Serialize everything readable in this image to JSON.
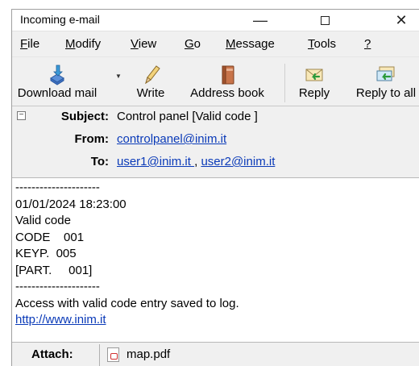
{
  "window": {
    "title": "Incoming e-mail",
    "minimize": "—",
    "close": "✕"
  },
  "menu": [
    {
      "label": "File",
      "underline": "F",
      "rest": "ile"
    },
    {
      "label": "Modify",
      "underline": "M",
      "rest": "odify"
    },
    {
      "label": "View",
      "underline": "V",
      "rest": "iew"
    },
    {
      "label": "Go",
      "underline": "G",
      "rest": "o"
    },
    {
      "label": "Message",
      "underline": "M",
      "rest": "essage"
    },
    {
      "label": "Tools",
      "underline": "T",
      "rest": "ools"
    },
    {
      "label": "?",
      "underline": "?",
      "rest": ""
    }
  ],
  "toolbar": {
    "download_label": "Download mail",
    "download_icon": "download-mail-icon",
    "write_label": "Write",
    "write_icon": "pencil-icon",
    "address_label": "Address book",
    "address_icon": "address-book-icon",
    "reply_label": "Reply",
    "reply_icon": "reply-icon",
    "reply_all_label": "Reply to all",
    "reply_all_icon": "reply-all-icon"
  },
  "headers": {
    "subject_label": "Subject:",
    "subject_value": "Control panel [Valid code   ]",
    "from_label": "From:",
    "from_value": "controlpanel@inim.it ",
    "to_label": "To:",
    "to_values": [
      "user1@inim.it ",
      "user2@inim.it "
    ],
    "to_separator": ","
  },
  "body": {
    "lines": [
      "---------------------",
      "01/01/2024 18:23:00",
      "Valid code",
      "CODE    001",
      "KEYP.  005",
      "[PART.     001]",
      "---------------------",
      "Access with valid code entry saved to log."
    ],
    "link": "http://www.inim.it"
  },
  "attach": {
    "label": "Attach:",
    "file_name": "map.pdf",
    "file_icon": "pdf-file-icon"
  },
  "colors": {
    "link": "#0a3ab8",
    "chrome": "#f0f0f0"
  }
}
